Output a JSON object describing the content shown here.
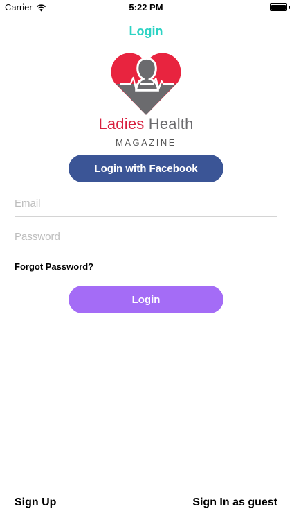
{
  "status_bar": {
    "carrier": "Carrier",
    "time": "5:22 PM",
    "battery_level": 1.0
  },
  "nav": {
    "title": "Login"
  },
  "brand": {
    "name_part1": "Ladies",
    "name_part2": "Health",
    "subtitle": "MAGAZINE"
  },
  "facebook_button": {
    "label": "Login with Facebook"
  },
  "email_field": {
    "placeholder": "Email",
    "value": ""
  },
  "password_field": {
    "placeholder": "Password",
    "value": ""
  },
  "forgot_password": {
    "label": "Forgot Password?"
  },
  "login_button": {
    "label": "Login"
  },
  "footer": {
    "sign_up": "Sign Up",
    "guest": "Sign In as guest"
  },
  "colors": {
    "accent": "#2dd3c4",
    "facebook": "#3b5596",
    "login": "#a46cf6",
    "heart_red": "#e8243f",
    "heart_gray": "#6b6b6e"
  },
  "icons": {
    "wifi": "wifi-icon",
    "battery": "battery-icon",
    "logo": "heart-silhouette-logo-icon"
  }
}
